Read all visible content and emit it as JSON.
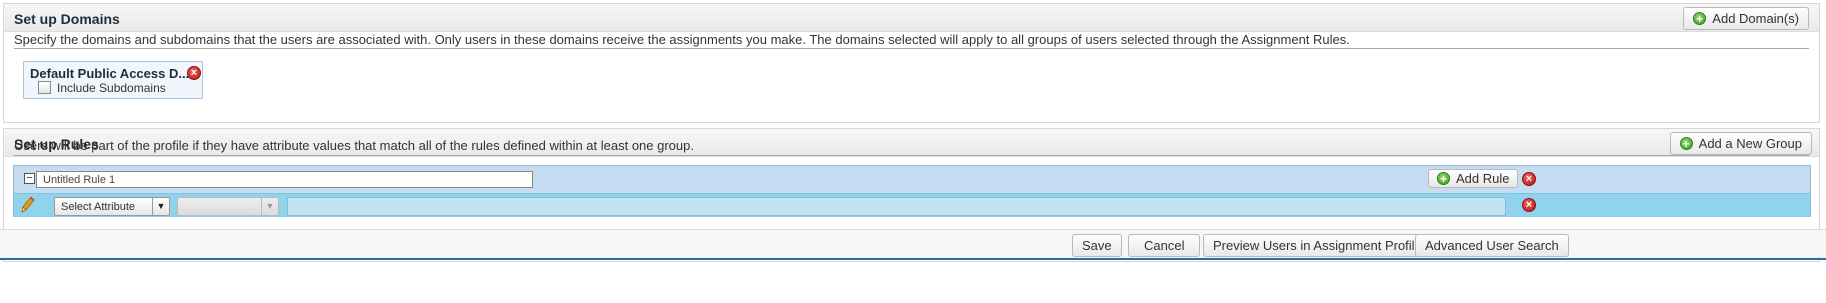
{
  "domains": {
    "title": "Set up Domains",
    "add_button": "Add Domain(s)",
    "description": "Specify the domains and subdomains that the users are associated with. Only users in these domains receive the assignments you make. The domains selected will apply to all groups of users selected through the Assignment Rules.",
    "items": [
      {
        "name": "Default Public Access D...",
        "include_subdomains_label": "Include Subdomains",
        "include_subdomains_checked": false
      }
    ]
  },
  "rules": {
    "title": "Set up Rules",
    "add_group_button": "Add a New Group",
    "description": "Users will be part of the profile if they have attribute values that match all of the rules defined within at least one group.",
    "groups": [
      {
        "collapse_symbol": "−",
        "rule_name": "Untitled Rule 1",
        "add_rule_button": "Add Rule",
        "rows": [
          {
            "attribute_select": "Select Attribute",
            "operator_select": "",
            "value": ""
          }
        ]
      }
    ]
  },
  "footer": {
    "save": "Save",
    "cancel": "Cancel",
    "preview": "Preview Users in Assignment Profile",
    "advanced_search": "Advanced User Search"
  },
  "icons": {
    "plus": "+",
    "remove": "×",
    "dropdown": "▼"
  },
  "colors": {
    "group_background": "#c6dcf2",
    "rule_row_background": "#8fd3ec",
    "remove_icon": "#c31b1b",
    "add_icon": "#3d9a23"
  }
}
